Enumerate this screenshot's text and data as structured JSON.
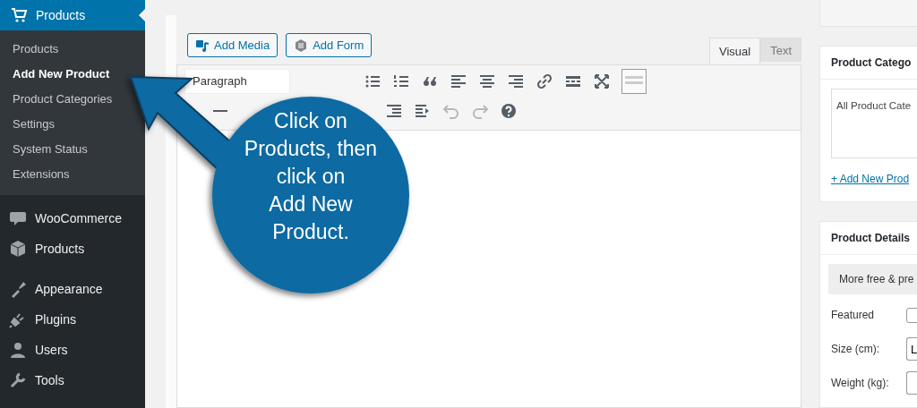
{
  "sidebar": {
    "current": {
      "label": "Products"
    },
    "submenu": [
      {
        "label": "Products",
        "selected": false
      },
      {
        "label": "Add New Product",
        "selected": true
      },
      {
        "label": "Product Categories",
        "selected": false
      },
      {
        "label": "Settings",
        "selected": false
      },
      {
        "label": "System Status",
        "selected": false
      },
      {
        "label": "Extensions",
        "selected": false
      }
    ],
    "menu": [
      {
        "label": "WooCommerce"
      },
      {
        "label": "Products"
      },
      {
        "label": "Appearance"
      },
      {
        "label": "Plugins"
      },
      {
        "label": "Users"
      },
      {
        "label": "Tools"
      }
    ]
  },
  "editor": {
    "buttons": [
      "Add Media",
      "Add Form"
    ],
    "tabs": [
      {
        "label": "Visual",
        "selected": true
      },
      {
        "label": "Text",
        "selected": false
      }
    ],
    "format_select": "Paragraph"
  },
  "callout": {
    "lines": [
      "Click on",
      "Products, then",
      "click on",
      "Add New",
      "Product."
    ]
  },
  "categories_box": {
    "title": "Product Catego",
    "list_item": "All Product Cate",
    "add_link": "+ Add New Prod"
  },
  "details_box": {
    "title": "Product Details",
    "notice": "More free & pre",
    "fields": [
      {
        "kind": "checkbox",
        "label": "Featured",
        "checked": false
      },
      {
        "kind": "text",
        "label": "Size (cm):",
        "value": "L"
      },
      {
        "kind": "text",
        "label": "Weight (kg):"
      }
    ]
  }
}
